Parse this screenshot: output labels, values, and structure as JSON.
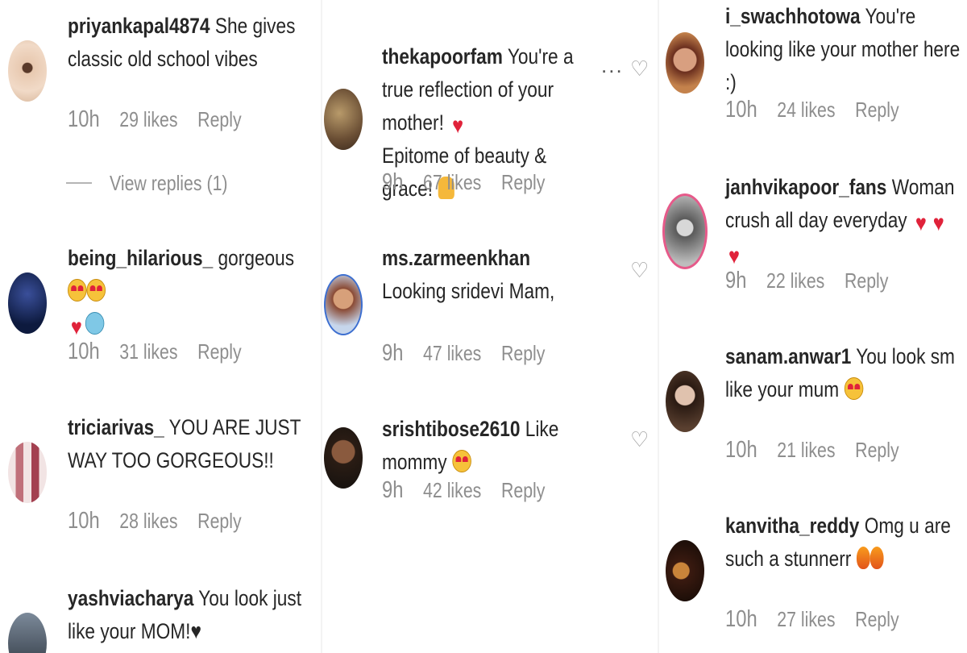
{
  "columns": [
    {
      "comments": [
        {
          "user": "priyankapal4874",
          "text": "She gives classic old school vibes",
          "time": "10h",
          "likes": "29 likes",
          "reply": "Reply"
        },
        {
          "user": "being_hilarious_",
          "text": "gorgeous",
          "time": "10h",
          "likes": "31 likes",
          "reply": "Reply"
        },
        {
          "user": "triciarivas_",
          "text": "YOU ARE JUST WAY TOO GORGEOUS!!",
          "time": "10h",
          "likes": "28 likes",
          "reply": "Reply"
        },
        {
          "user": "yashviacharya",
          "text": "You look just like your MOM!♥"
        }
      ],
      "view_replies": "View replies (1)"
    },
    {
      "comments": [
        {
          "user": "thekapoorfam",
          "text": "You're a true reflection of your mother!",
          "text2": "Epitome of beauty & grace!",
          "time": "9h",
          "likes": "67 likes",
          "reply": "Reply"
        },
        {
          "user": "ms.zarmeenkhan",
          "text": "Looking sridevi Mam,",
          "time": "9h",
          "likes": "47 likes",
          "reply": "Reply"
        },
        {
          "user": "srishtibose2610",
          "text": "Like mommy",
          "time": "9h",
          "likes": "42 likes",
          "reply": "Reply"
        }
      ],
      "more": "..."
    },
    {
      "comments": [
        {
          "user": "i_swachhotowa",
          "text": "You're looking like your mother here :)",
          "time": "10h",
          "likes": "24 likes",
          "reply": "Reply"
        },
        {
          "user": "janhvikapoor_fans",
          "text": "Woman crush all day everyday",
          "time": "9h",
          "likes": "22 likes",
          "reply": "Reply"
        },
        {
          "user": "sanam.anwar1",
          "text": "You look sm like your mum",
          "time": "10h",
          "likes": "21 likes",
          "reply": "Reply"
        },
        {
          "user": "kanvitha_reddy",
          "text": "Omg u are such a stunnerr",
          "time": "10h",
          "likes": "27 likes",
          "reply": "Reply"
        }
      ]
    }
  ],
  "icons": {
    "heart": "heart-outline-icon",
    "more": "more-options-icon"
  },
  "colors": {
    "text": "#262626",
    "meta": "#8e8e8e",
    "emoji_heart": "#e0223a"
  }
}
